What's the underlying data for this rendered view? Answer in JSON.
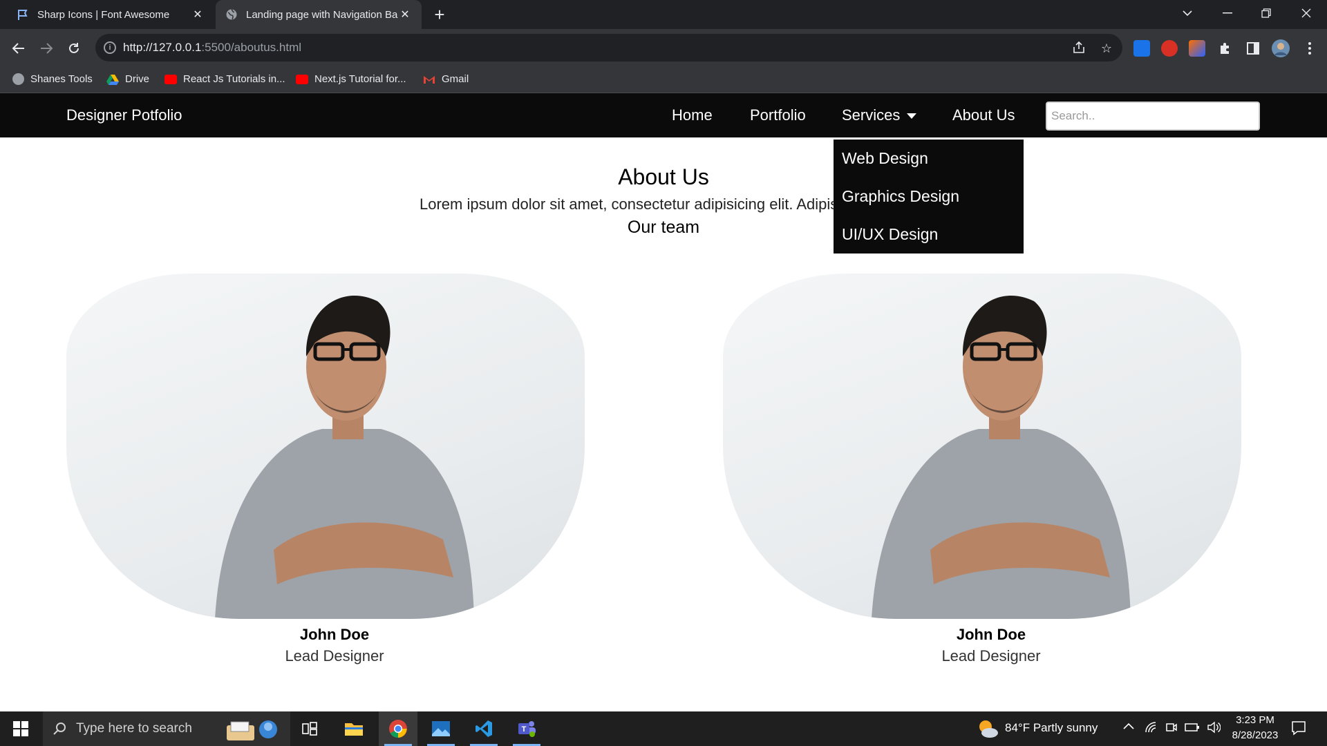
{
  "browser": {
    "tabs": [
      {
        "title": "Sharp Icons | Font Awesome",
        "active": false,
        "icon": "flag-icon"
      },
      {
        "title": "Landing page with Navigation Ba",
        "active": true,
        "icon": "globe-icon"
      }
    ],
    "new_tab_label": "+",
    "url_host": "http://127.0.0.1",
    "url_rest": ":5500/aboutus.html",
    "bookmarks": [
      {
        "label": "Shanes Tools",
        "icon": "globe-icon"
      },
      {
        "label": "Drive",
        "icon": "drive-icon"
      },
      {
        "label": "React Js Tutorials in...",
        "icon": "youtube-icon"
      },
      {
        "label": "Next.js Tutorial for...",
        "icon": "youtube-icon"
      },
      {
        "label": "Gmail",
        "icon": "gmail-icon"
      }
    ]
  },
  "site": {
    "brand": "Designer Potfolio",
    "nav": {
      "home": "Home",
      "portfolio": "Portfolio",
      "services": "Services",
      "about": "About Us"
    },
    "search_placeholder": "Search..",
    "dropdown": [
      "Web Design",
      "Graphics Design",
      "UI/UX Design"
    ],
    "about_title": "About Us",
    "about_text": "Lorem ipsum dolor sit amet, consectetur adipisicing elit. Adipisci",
    "team_title": "Our team",
    "members": [
      {
        "name": "John Doe",
        "role": "Lead Designer"
      },
      {
        "name": "John Doe",
        "role": "Lead Designer"
      }
    ]
  },
  "taskbar": {
    "search_placeholder": "Type here to search",
    "weather": "84°F  Partly sunny",
    "time": "3:23 PM",
    "date": "8/28/2023"
  },
  "colors": {
    "nav_bg": "#0b0b0b",
    "chrome_dark": "#202124",
    "chrome_toolbar": "#35363a"
  }
}
